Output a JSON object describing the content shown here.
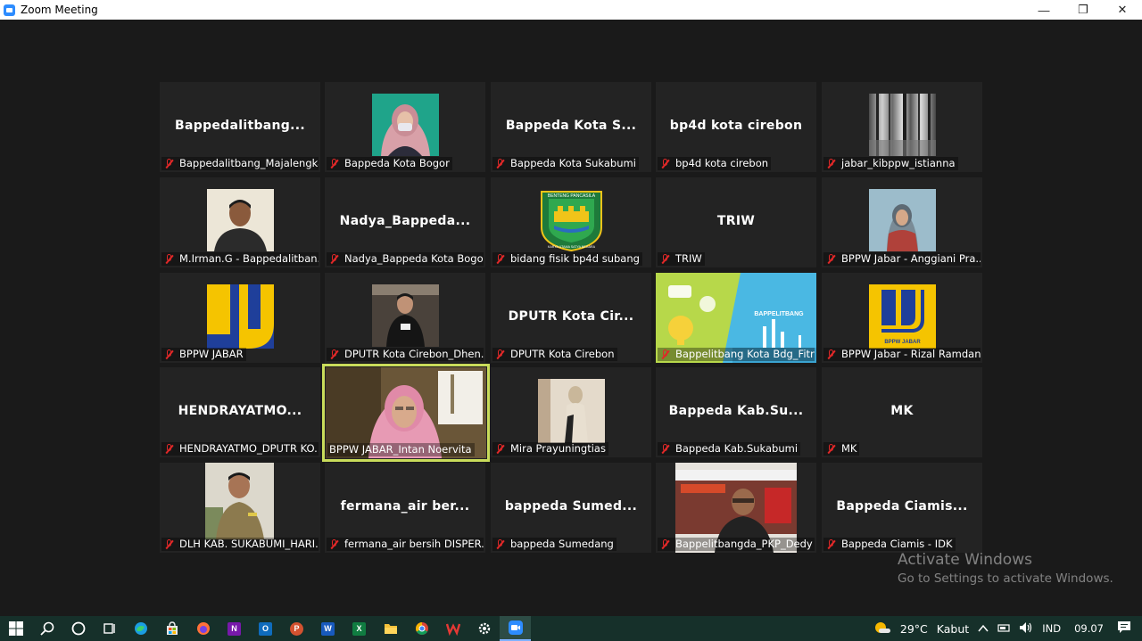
{
  "window": {
    "title": "Zoom Meeting",
    "minimize": "—",
    "restore": "❐",
    "close": "✕"
  },
  "tiles": [
    {
      "name": "Bappedalitbang...",
      "label": "Bappedalitbang_Majalengka",
      "muted": true
    },
    {
      "name": "",
      "label": "Bappeda Kota Bogor",
      "muted": true,
      "video": "woman-hijab-mask"
    },
    {
      "name": "Bappeda Kota S...",
      "label": "Bappeda Kota Sukabumi",
      "muted": true
    },
    {
      "name": "bp4d kota cirebon",
      "label": "bp4d kota cirebon",
      "muted": true
    },
    {
      "name": "",
      "label": "jabar_kibppw_istianna",
      "muted": true,
      "video": "forest-photo"
    },
    {
      "name": "",
      "label": "M.Irman.G - Bappedalitban...",
      "muted": true,
      "video": "man-portrait"
    },
    {
      "name": "Nadya_Bappeda...",
      "label": "Nadya_Bappeda Kota Bogor",
      "muted": true
    },
    {
      "name": "",
      "label": "bidang fisik bp4d subang",
      "muted": true,
      "video": "subang-emblem"
    },
    {
      "name": "TRIW",
      "label": "TRIW",
      "muted": true
    },
    {
      "name": "",
      "label": "BPPW Jabar - Anggiani Pra...",
      "muted": true,
      "video": "woman-scarf"
    },
    {
      "name": "",
      "label": "BPPW JABAR",
      "muted": true,
      "video": "pu-logo"
    },
    {
      "name": "",
      "label": "DPUTR Kota Cirebon_Dhen...",
      "muted": true,
      "video": "man-standing"
    },
    {
      "name": "DPUTR Kota Cir...",
      "label": "DPUTR Kota Cirebon",
      "muted": true
    },
    {
      "name": "",
      "label": "Bappelitbang Kota Bdg_Fitri...",
      "muted": true,
      "video": "bappelitbang-banner"
    },
    {
      "name": "",
      "label": "BPPW Jabar - Rizal Ramdani",
      "muted": true,
      "video": "pu-logo-jabar"
    },
    {
      "name": "HENDRAYATMO...",
      "label": "HENDRAYATMO_DPUTR KO...",
      "muted": true
    },
    {
      "name": "",
      "label": "BPPW JABAR_Intan Noervita",
      "muted": false,
      "active": true,
      "video": "woman-hijab-pink"
    },
    {
      "name": "",
      "label": "Mira Prayuningtias",
      "muted": true,
      "video": "woman-standing"
    },
    {
      "name": "Bappeda Kab.Su...",
      "label": "Bappeda Kab.Sukabumi",
      "muted": true
    },
    {
      "name": "MK",
      "label": "MK",
      "muted": true
    },
    {
      "name": "",
      "label": "DLH KAB. SUKABUMI_HARI...",
      "muted": true,
      "video": "man-uniform"
    },
    {
      "name": "fermana_air  ber...",
      "label": "fermana_air bersih DISPER...",
      "muted": true
    },
    {
      "name": "bappeda  Sumed...",
      "label": "bappeda Sumedang",
      "muted": true
    },
    {
      "name": "",
      "label": "Bappelitbangda_PKP_Dedy",
      "muted": true,
      "video": "man-office"
    },
    {
      "name": "Bappeda  Ciamis...",
      "label": "Bappeda Ciamis - IDK",
      "muted": true
    }
  ],
  "emblem_text": {
    "subang_top": "BENTENG PANCASILA",
    "subang_bottom": "KARYA UTAMA SATYA NEGARA",
    "pu_jabar": "BPPW JABAR",
    "bappelitbang": "BAPPELITBANG"
  },
  "watermark": {
    "line1": "Activate Windows",
    "line2": "Go to Settings to activate Windows."
  },
  "taskbar": {
    "apps": [
      "windows-start",
      "search",
      "cortana",
      "task-view",
      "edge",
      "store",
      "firefox",
      "onenote",
      "outlook",
      "powerpoint",
      "word",
      "excel",
      "file-explorer",
      "chrome",
      "wps",
      "settings",
      "zoom"
    ],
    "weather_temp": "29°C",
    "weather_text": "Kabut",
    "language": "IND",
    "time": "09.07"
  },
  "colors": {
    "active_border": "#c9dc5a",
    "muted_icon": "#e02828",
    "tile_bg": "#232323",
    "stage_bg": "#1a1a1a",
    "taskbar_bg": "#16302a"
  }
}
